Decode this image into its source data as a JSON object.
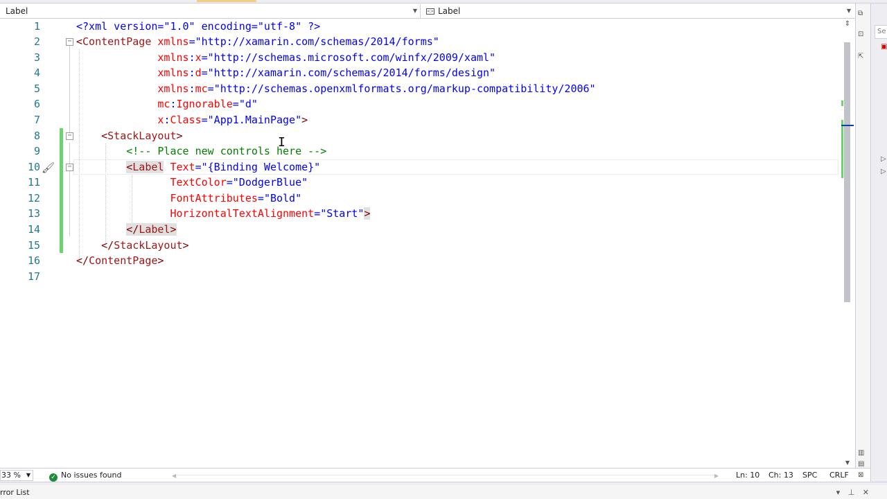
{
  "navbar": {
    "left_dropdown": "Label",
    "right_dropdown": "Label"
  },
  "editor": {
    "lines": [
      {
        "n": "1"
      },
      {
        "n": "2"
      },
      {
        "n": "3"
      },
      {
        "n": "4"
      },
      {
        "n": "5"
      },
      {
        "n": "6"
      },
      {
        "n": "7"
      },
      {
        "n": "8"
      },
      {
        "n": "9"
      },
      {
        "n": "10"
      },
      {
        "n": "11"
      },
      {
        "n": "12"
      },
      {
        "n": "13"
      },
      {
        "n": "14"
      },
      {
        "n": "15"
      },
      {
        "n": "16"
      },
      {
        "n": "17"
      }
    ],
    "code": {
      "l1_pi": "<?xml version=\"1.0\" encoding=\"utf-8\" ?>",
      "l2_tag": "ContentPage",
      "l2_attr": "xmlns",
      "l2_val": "\"http://xamarin.com/schemas/2014/forms\"",
      "l3_ns": "xmlns",
      "l3_attr": "x",
      "l3_val": "\"http://schemas.microsoft.com/winfx/2009/xaml\"",
      "l4_ns": "xmlns",
      "l4_attr": "d",
      "l4_val": "\"http://xamarin.com/schemas/2014/forms/design\"",
      "l5_ns": "xmlns",
      "l5_attr": "mc",
      "l5_val": "\"http://schemas.openxmlformats.org/markup-compatibility/2006\"",
      "l6_ns": "mc",
      "l6_attr": "Ignorable",
      "l6_val": "\"d\"",
      "l7_ns": "x",
      "l7_attr": "Class",
      "l7_val": "\"App1.MainPage\"",
      "l8_tag": "StackLayout",
      "l9_comment": "<!-- Place new controls here -->",
      "l10_tag_a": "Lab",
      "l10_tag_b": "el",
      "l10_attr": "Text",
      "l10_val": "\"{Binding Welcome}\"",
      "l11_attr": "TextColor",
      "l11_val": "\"DodgerBlue\"",
      "l12_attr": "FontAttributes",
      "l12_val": "\"Bold\"",
      "l13_attr": "HorizontalTextAlignment",
      "l13_val": "\"Start\"",
      "l14_tag": "Label",
      "l15_tag": "StackLayout",
      "l16_tag": "ContentPage"
    }
  },
  "statusbar": {
    "zoom": "33 %",
    "issues": "No issues found",
    "line": "Ln: 10",
    "col": "Ch: 13",
    "encoding": "SPC",
    "eol": "CRLF"
  },
  "side_panel": {
    "search_hint": "Se"
  },
  "bottom_panel": {
    "title": "rror List"
  },
  "colors": {
    "line_number": "#237893",
    "tag": "#a31515",
    "attribute": "#ff0000",
    "value": "#0000ff",
    "comment": "#008000",
    "modified_margin": "#6cd46c",
    "success_icon": "#1e8d3a"
  }
}
